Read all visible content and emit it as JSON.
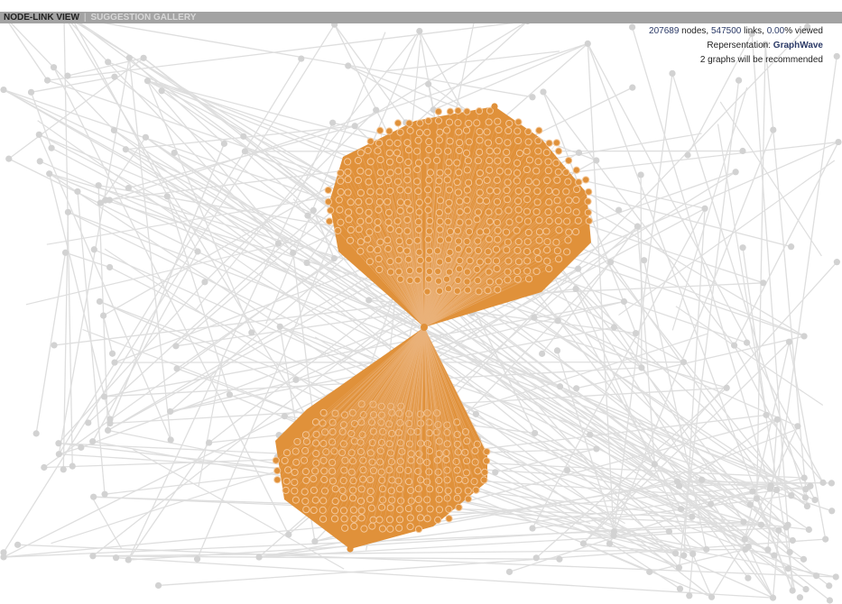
{
  "tabs": [
    {
      "label": "NODE-LINK VIEW",
      "active": true
    },
    {
      "label": "SUGGESTION GALLERY",
      "active": false
    }
  ],
  "stats": {
    "nodes": "207689",
    "nodes_label": " nodes, ",
    "links": "547500",
    "links_label": " links, ",
    "viewed": "0.00",
    "viewed_label": "% viewed"
  },
  "representation": {
    "label": "Repersentation: ",
    "value": "GraphWave"
  },
  "recommendation": {
    "count": "2",
    "text": " graphs will be recommended"
  },
  "colors": {
    "highlight": "#e0913a",
    "background_edge": "#dedede",
    "background_node": "#d2d2d2",
    "topbar": "#a3a3a3"
  }
}
